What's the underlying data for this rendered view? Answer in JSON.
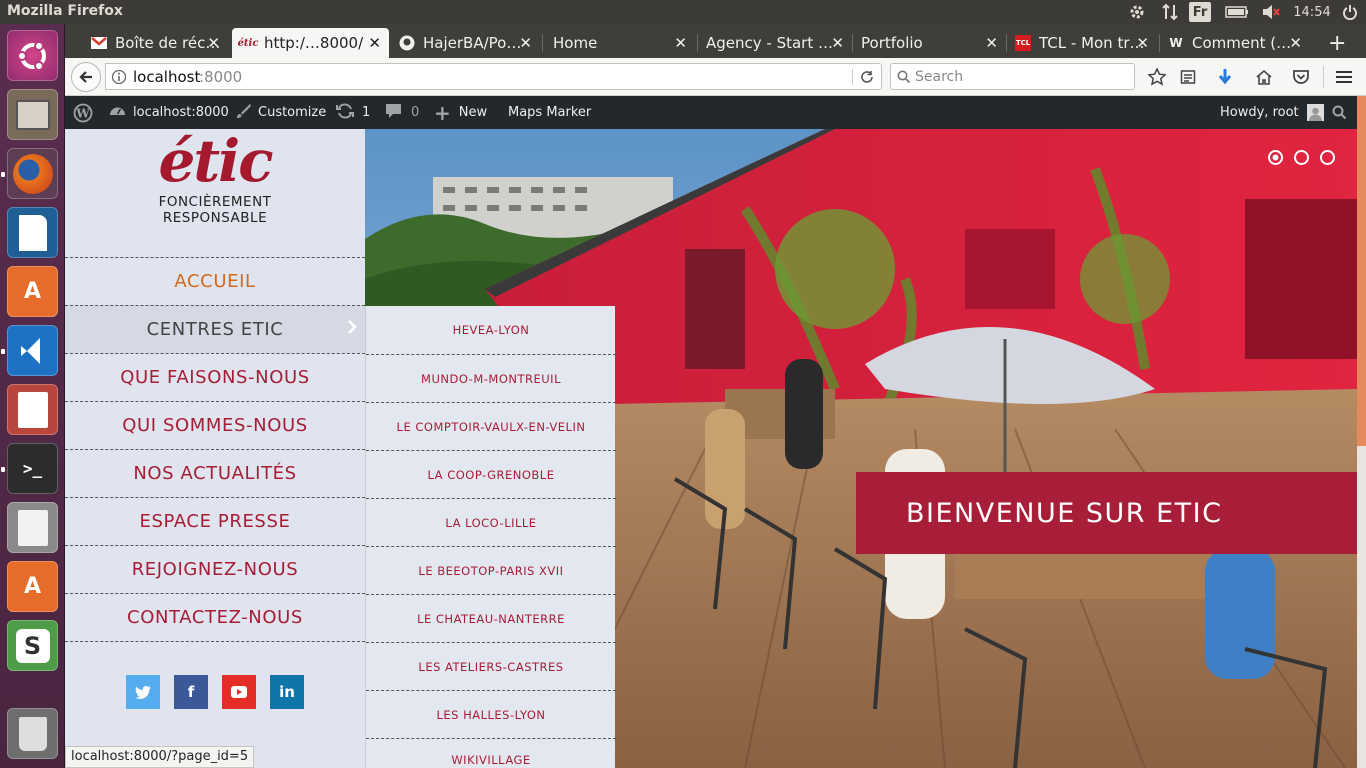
{
  "topbar": {
    "window_title": "Mozilla Firefox",
    "keyboard_layout": "Fr",
    "clock": "14:54",
    "icons": [
      "settings-icon",
      "network-icon",
      "keyboard-icon",
      "battery-icon",
      "volume-muted-icon",
      "power-icon"
    ]
  },
  "launcher": {
    "items": [
      "ubuntu-dash",
      "files",
      "firefox",
      "libreoffice-writer",
      "ubuntu-software",
      "vscode",
      "document-viewer",
      "terminal",
      "text-editor",
      "ubuntu-software-2",
      "slack",
      "trash"
    ]
  },
  "tabs": [
    {
      "label": "Boîte de réc…",
      "icon": "gmail-icon"
    },
    {
      "label": "http:/…8000/",
      "icon": "etic-icon",
      "active": true
    },
    {
      "label": "HajerBA/Po…",
      "icon": "github-icon"
    },
    {
      "label": "Home",
      "icon": ""
    },
    {
      "label": "Agency - Start …",
      "icon": ""
    },
    {
      "label": "Portfolio",
      "icon": ""
    },
    {
      "label": "TCL - Mon tr…",
      "icon": "tcl-icon"
    },
    {
      "label": "Comment (…",
      "icon": "wordpress-icon"
    }
  ],
  "nav": {
    "url_host": "localhost",
    "url_port": ":8000",
    "search_placeholder": "Search"
  },
  "wpbar": {
    "site": "localhost:8000",
    "customize": "Customize",
    "updates_count": "1",
    "comments_count": "0",
    "new": "New",
    "plugin": "Maps Marker",
    "howdy": "Howdy, root"
  },
  "site": {
    "logo_word": "étic",
    "logo_line1": "FONCIÈREMENT",
    "logo_line2": "RESPONSABLE",
    "menu": [
      {
        "label": "ACCUEIL",
        "active": true
      },
      {
        "label": "CENTRES ETIC",
        "has_sub": true
      },
      {
        "label": "QUE FAISONS-NOUS"
      },
      {
        "label": "QUI SOMMES-NOUS"
      },
      {
        "label": "NOS ACTUALITÉS"
      },
      {
        "label": "ESPACE PRESSE"
      },
      {
        "label": "REJOIGNEZ-NOUS"
      },
      {
        "label": "CONTACTEZ-NOUS"
      }
    ],
    "social": [
      "twitter-icon",
      "facebook-icon",
      "youtube-icon",
      "linkedin-icon"
    ],
    "submenu": [
      "HEVEA-LYON",
      "MUNDO-M-MONTREUIL",
      "LE COMPTOIR-VAULX-EN-VELIN",
      "LA COOP-GRENOBLE",
      "LA LOCO-LILLE",
      "LE BEEOTOP-PARIS XVII",
      "LE CHATEAU-NANTERRE",
      "LES ATELIERS-CASTRES",
      "LES HALLES-LYON",
      "WIKIVILLAGE"
    ],
    "welcome": "BIENVENUE SUR ETIC",
    "slider_active_index": 0,
    "slider_count": 3
  },
  "status_url": "localhost:8000/?page_id=5",
  "colors": {
    "brand_red": "#a81d38",
    "menu_active": "#d2691e",
    "sidebar_bg": "#dfe4ee"
  }
}
